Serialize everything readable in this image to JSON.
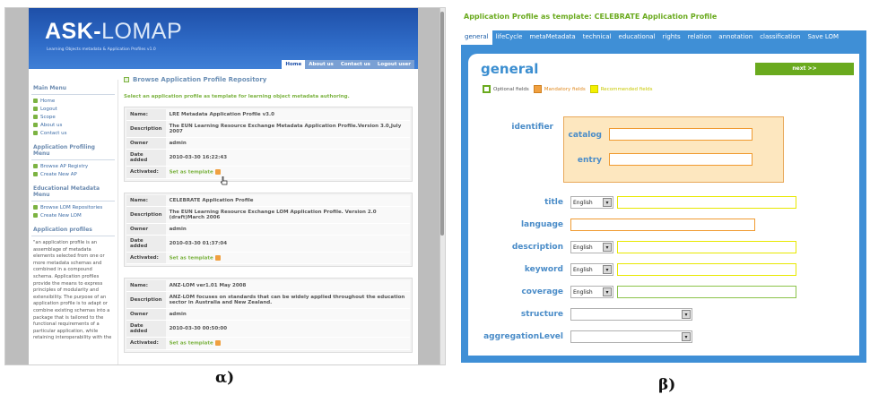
{
  "panel_a": {
    "logo": {
      "main": "ASK-",
      "rest": "LOMAP",
      "tagline": "Learning Objects metadata & Application Profiles v1.0"
    },
    "nav": [
      "Home",
      "About us",
      "Contact us",
      "Logout user"
    ],
    "sidebar": {
      "main_menu": {
        "title": "Main Menu",
        "items": [
          "Home",
          "Logout",
          "Scope",
          "About us",
          "Contact us"
        ]
      },
      "ap_menu": {
        "title": "Application Profiling Menu",
        "items": [
          "Browse AP Registry",
          "Create New AP"
        ]
      },
      "em_menu": {
        "title": "Educational Metadata Menu",
        "items": [
          "Browse LOM Repositories",
          "Create New LOM"
        ]
      },
      "ap_info": {
        "title": "Application profiles",
        "text": "\"an application profile is an assemblage of metadata elements selected from one or more metadata schemas and combined in a compound schema. Application profiles provide the means to express principles of modularity and extensibility. The purpose of an application profile is to adapt or combine existing schemas into a package that is tailored to the functional requirements of a particular application, while retaining interoperability with the"
      }
    },
    "main": {
      "heading": "Browse Application Profile Repository",
      "subheading": "Select an application profile as template for learning object metadata authoring.",
      "labels": {
        "name": "Name:",
        "description": "Description",
        "owner": "Owner",
        "date": "Date added",
        "activated": "Activated:"
      },
      "profiles": [
        {
          "name": "LRE Metadata Application Profile v3.0",
          "description": "The EUN Learning Resource Exchange Metadata Application Profile.Version 3.0,July 2007",
          "owner": "admin",
          "date": "2010-03-30 16:22:43",
          "action": "Set as template"
        },
        {
          "name": "CELEBRATE Application Profile",
          "description": "The EUN Learning Resource Exchange LOM Application Profile. Version 2.0 (draft)March 2006",
          "owner": "admin",
          "date": "2010-03-30 01:37:04",
          "action": "Set as template"
        },
        {
          "name": "ANZ-LOM ver1.01 May 2008",
          "description": "ANZ-LOM focuses on standards that can be widely applied throughout the education sector in Australia and New Zealand.",
          "owner": "admin",
          "date": "2010-03-30 00:50:00",
          "action": "Set as template"
        }
      ]
    },
    "caption": "α)"
  },
  "panel_b": {
    "title": "Application Profile as template: CELEBRATE Application Profile",
    "tabs": [
      "general",
      "lifeCycle",
      "metaMetadata",
      "technical",
      "educational",
      "rights",
      "relation",
      "annotation",
      "classification",
      "Save LOM"
    ],
    "section": "general",
    "next_button": "next >>",
    "legend": {
      "optional": "Optional fields",
      "mandatory": "Mandatory fields",
      "recommended": "Recommended fields"
    },
    "fields": {
      "identifier": "identifier",
      "catalog": "catalog",
      "entry": "entry",
      "title": "title",
      "language": "language",
      "description": "description",
      "keyword": "keyword",
      "coverage": "coverage",
      "structure": "structure",
      "aggregationLevel": "aggregationLevel"
    },
    "lang_value": "English",
    "caption": "β)"
  },
  "colors": {
    "optional": "#8bc34a",
    "mandatory": "#f09a30",
    "recommended": "#e8e800",
    "accent_blue": "#3f8fd6",
    "accent_green": "#6aaa1e"
  }
}
